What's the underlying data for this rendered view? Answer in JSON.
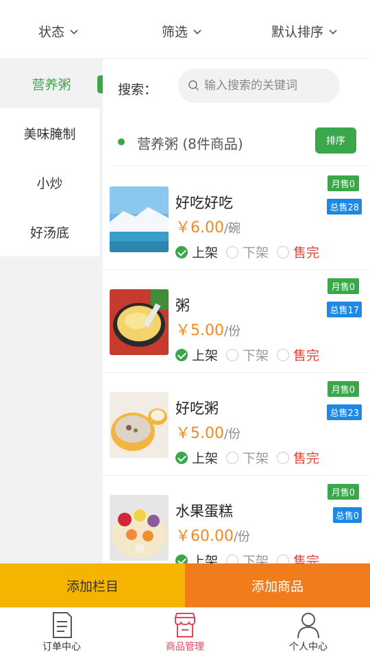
{
  "filters": {
    "status": "状态",
    "filter": "筛选",
    "sort": "默认排序"
  },
  "sidebar": {
    "items": [
      {
        "label": "营养粥",
        "active": true
      },
      {
        "label": "美味腌制",
        "active": false
      },
      {
        "label": "小炒",
        "active": false
      },
      {
        "label": "好汤底",
        "active": false
      }
    ]
  },
  "search": {
    "label": "搜索：",
    "placeholder": "输入搜索的关键词"
  },
  "category": {
    "title": "营养粥 (8件商品)",
    "sort_button": "排序"
  },
  "status_labels": {
    "on": "上架",
    "off": "下架",
    "sold_out": "售完"
  },
  "products": [
    {
      "name": "好吃好吃",
      "price": "￥6.00",
      "unit": "/碗",
      "month_sales": "月售0",
      "total_sales": "总售28",
      "status": "on"
    },
    {
      "name": "粥",
      "price": "￥5.00",
      "unit": "/份",
      "month_sales": "月售0",
      "total_sales": "总售17",
      "status": "on"
    },
    {
      "name": "好吃粥",
      "price": "￥5.00",
      "unit": "/份",
      "month_sales": "月售0",
      "total_sales": "总售23",
      "status": "on"
    },
    {
      "name": "水果蛋糕",
      "price": "￥60.00",
      "unit": "/份",
      "month_sales": "月售0",
      "total_sales": "总售0",
      "status": "on"
    }
  ],
  "actions": {
    "add_column": "添加栏目",
    "add_product": "添加商品"
  },
  "tabs": [
    {
      "label": "订单中心",
      "icon": "document-icon",
      "active": false
    },
    {
      "label": "商品管理",
      "icon": "store-icon",
      "active": true
    },
    {
      "label": "个人中心",
      "icon": "person-icon",
      "active": false
    }
  ],
  "colors": {
    "primary_green": "#3aa84a",
    "price_orange": "#f08a1c",
    "sold_red": "#e0453a",
    "total_blue": "#1e88e5",
    "btn_yellow": "#f5b400",
    "btn_orange": "#f07c1c",
    "tab_active": "#e0455a"
  }
}
